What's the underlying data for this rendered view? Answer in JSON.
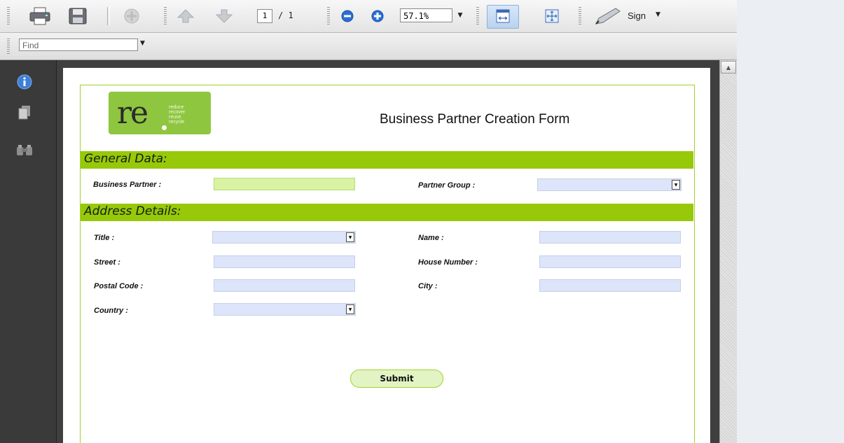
{
  "toolbar": {
    "page_current": "1",
    "page_total": "/ 1",
    "zoom": "57.1%",
    "sign_label": "Sign"
  },
  "find": {
    "placeholder": "Find"
  },
  "form": {
    "title": "Business Partner Creation Form",
    "logo": {
      "text": "re",
      "words": [
        "reduce",
        "recover",
        "reuse",
        "recycle"
      ]
    },
    "sections": {
      "general": "General Data:",
      "address": "Address Details:"
    },
    "labels": {
      "business_partner": "Business Partner :",
      "partner_group": "Partner Group :",
      "title": "Title :",
      "name": "Name :",
      "street": "Street :",
      "house_number": "House Number :",
      "postal_code": "Postal Code :",
      "city": "City :",
      "country": "Country :"
    },
    "submit": "Submit"
  },
  "colors": {
    "accent_green": "#97c80a",
    "field_blue": "#dde5fa",
    "field_green": "#d9f2a3"
  },
  "icons": [
    "print-icon",
    "save-icon",
    "share-icon",
    "prev-page-icon",
    "next-page-icon",
    "zoom-out-icon",
    "zoom-in-icon",
    "fit-width-icon",
    "fit-page-icon",
    "sign-pen-icon",
    "info-icon",
    "pages-icon",
    "attachments-icon"
  ]
}
